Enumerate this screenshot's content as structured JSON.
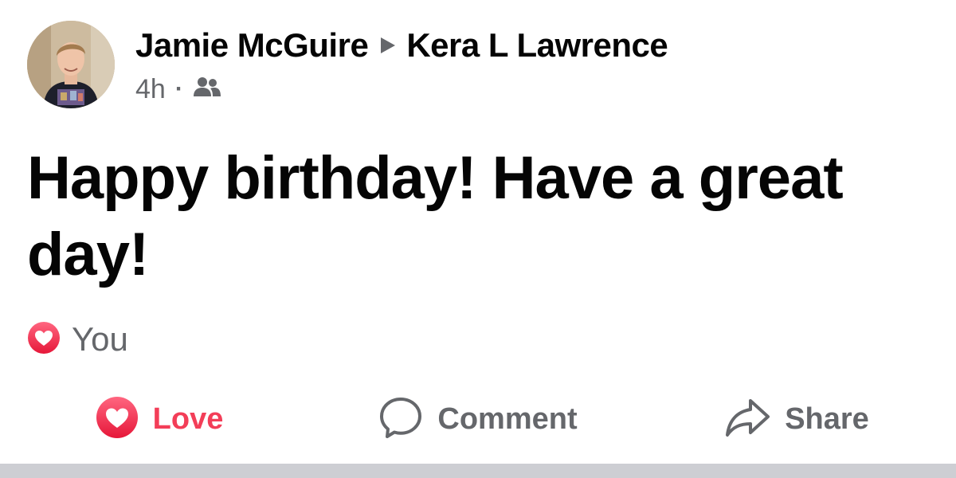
{
  "post": {
    "author": "Jamie McGuire",
    "recipient": "Kera L Lawrence",
    "time": "4h",
    "separator": "·",
    "audience_icon": "friends-icon",
    "message": "Happy birthday! Have a great day!",
    "reactions": {
      "icon": "love-reaction-icon",
      "reactor": "You"
    }
  },
  "actions": {
    "love_label": "Love",
    "comment_label": "Comment",
    "share_label": "Share"
  },
  "colors": {
    "love": "#f33e58",
    "secondary_text": "#65676b",
    "primary_text": "#050505",
    "divider": "#cdced3"
  }
}
